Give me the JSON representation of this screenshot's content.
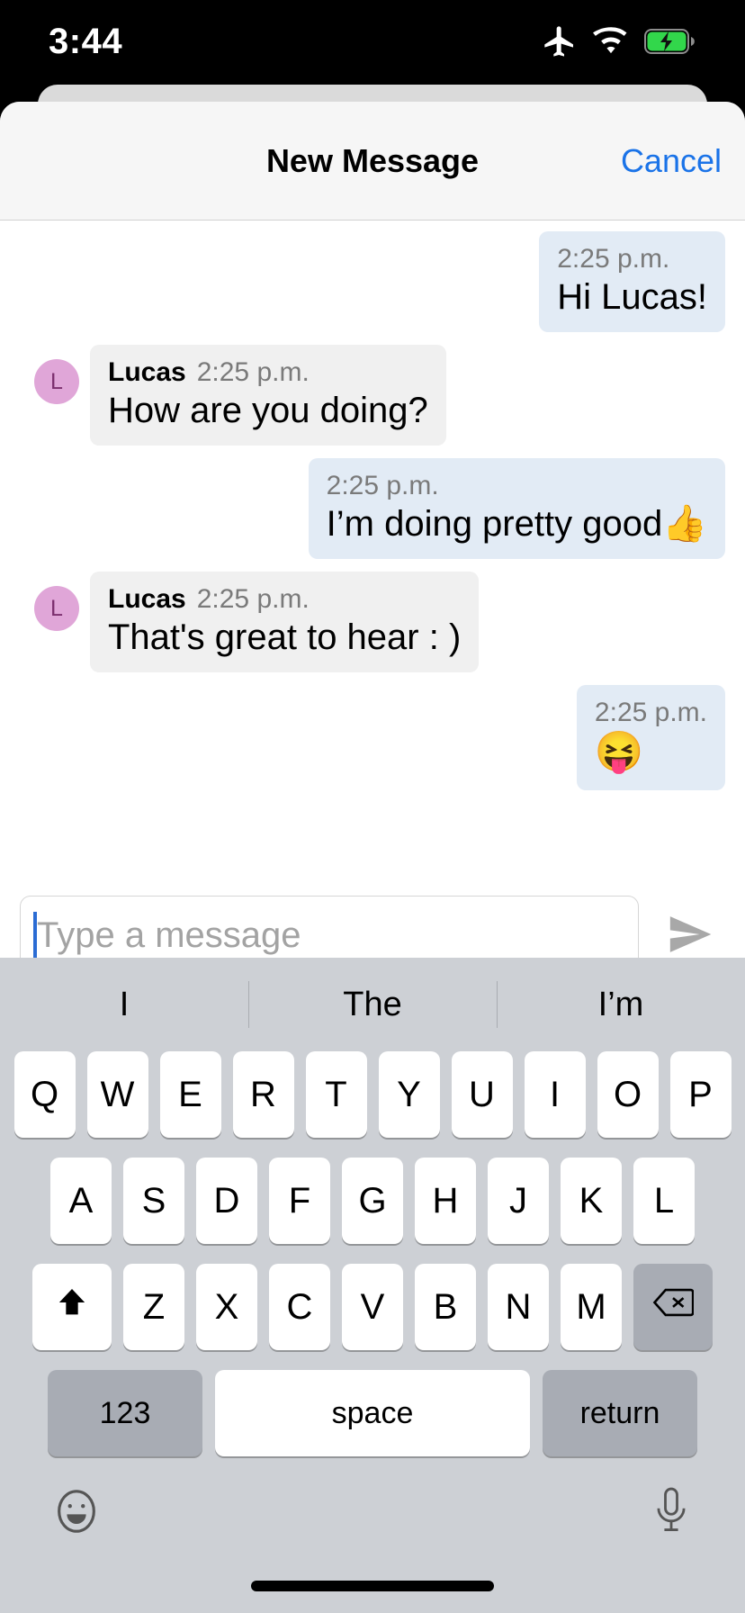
{
  "status_bar": {
    "time": "3:44",
    "icons": [
      "airplane-mode-icon",
      "wifi-icon",
      "battery-charging-icon"
    ]
  },
  "sheet": {
    "title": "New Message",
    "cancel_label": "Cancel"
  },
  "conversation": {
    "participant": "Lucas",
    "avatar_initial": "L",
    "messages": [
      {
        "direction": "out",
        "sender": "",
        "time": "2:25 p.m.",
        "text": "Hi Lucas!"
      },
      {
        "direction": "in",
        "sender": "Lucas",
        "time": "2:25 p.m.",
        "text": "How are you doing?"
      },
      {
        "direction": "out",
        "sender": "",
        "time": "2:25 p.m.",
        "text": "I’m doing pretty good👍"
      },
      {
        "direction": "in",
        "sender": "Lucas",
        "time": "2:25 p.m.",
        "text": "That's great to hear : )"
      },
      {
        "direction": "out",
        "sender": "",
        "time": "2:25 p.m.",
        "text": "😝"
      }
    ]
  },
  "composer": {
    "placeholder": "Type a message",
    "value": "",
    "send_label": "send-icon"
  },
  "keyboard": {
    "suggestions": [
      "I",
      "The",
      "I’m"
    ],
    "row1": [
      "Q",
      "W",
      "E",
      "R",
      "T",
      "Y",
      "U",
      "I",
      "O",
      "P"
    ],
    "row2": [
      "A",
      "S",
      "D",
      "F",
      "G",
      "H",
      "J",
      "K",
      "L"
    ],
    "row3": [
      "Z",
      "X",
      "C",
      "V",
      "B",
      "N",
      "M"
    ],
    "shift_label": "shift-icon",
    "backspace_label": "backspace-icon",
    "num_label": "123",
    "space_label": "space",
    "return_label": "return",
    "emoji_label": "emoji-icon",
    "mic_label": "microphone-icon"
  },
  "colors": {
    "accent": "#1a73e8",
    "bubble_out": "#e2ebf5",
    "bubble_in": "#f0f0f0",
    "avatar": "#e0a6d8",
    "keyboard_bg": "#cdd0d5",
    "caret": "#2b6cd4"
  }
}
